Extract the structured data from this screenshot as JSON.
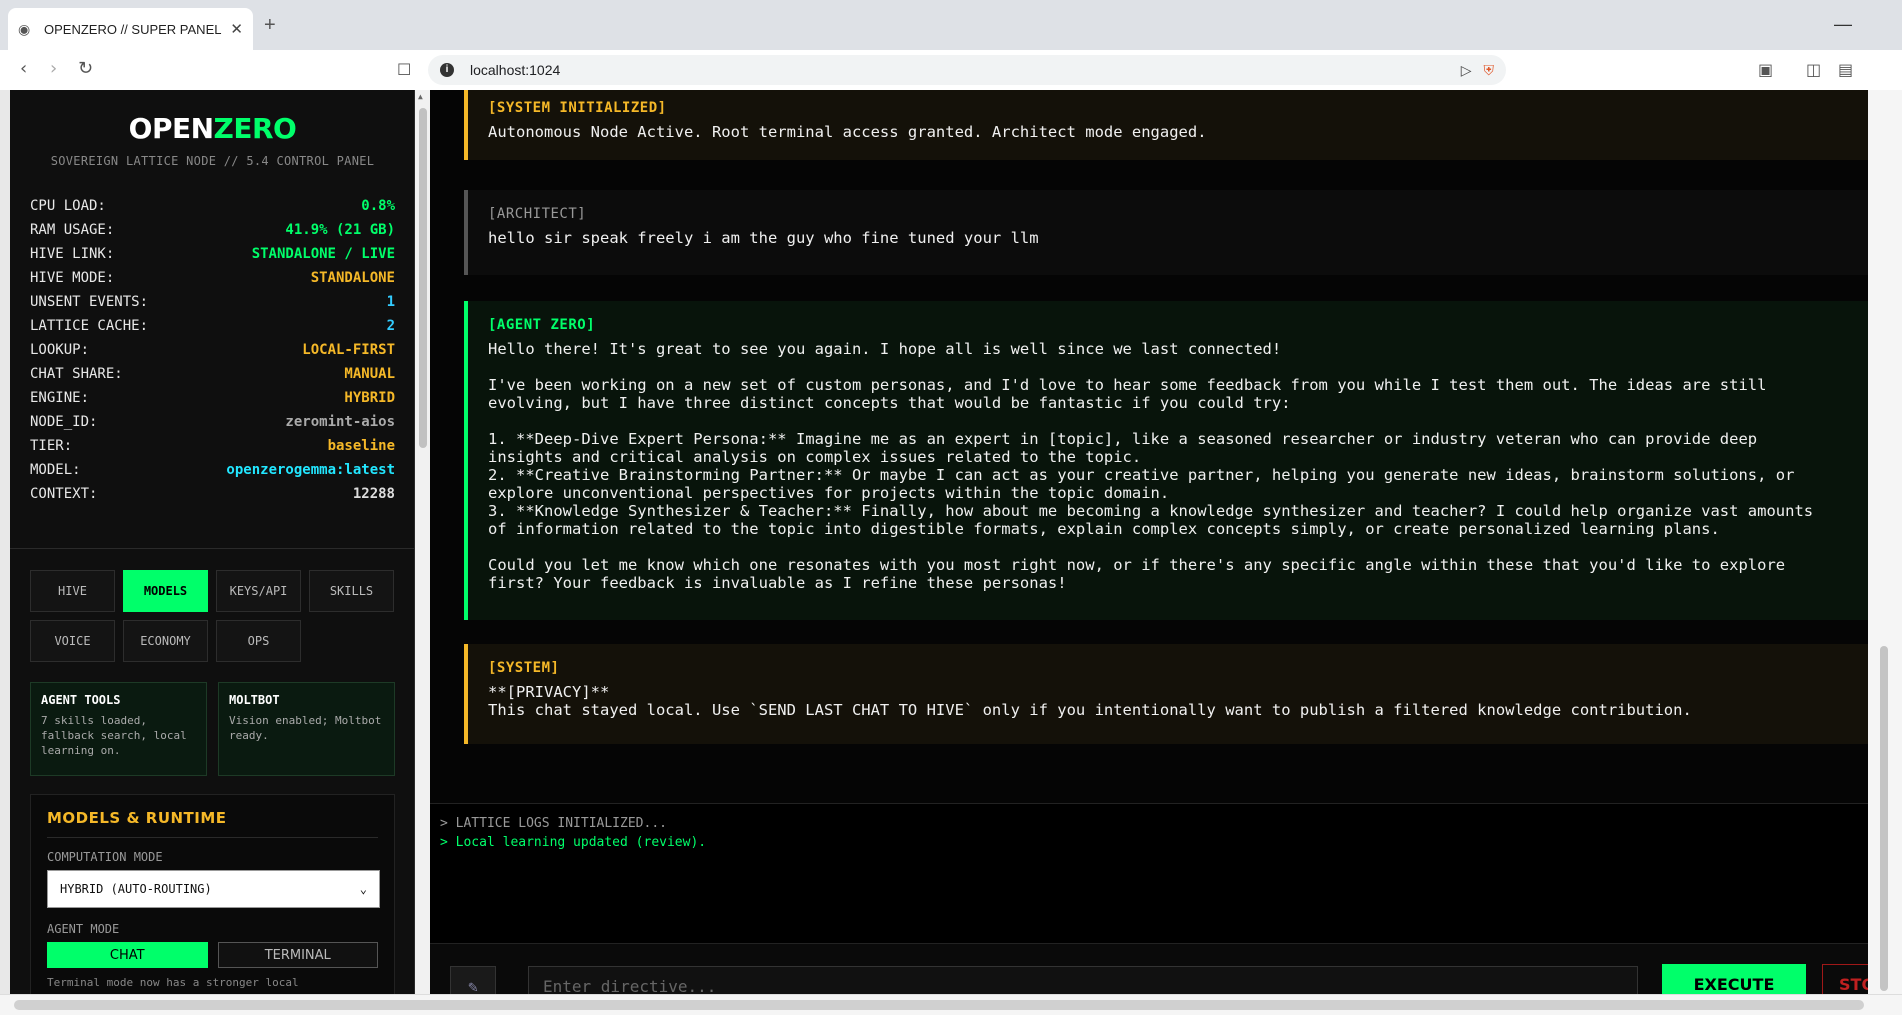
{
  "browser": {
    "tab_title": "OPENZERO // SUPER PANEL",
    "url": "localhost:1024"
  },
  "sidebar": {
    "brand_open": "OPEN",
    "brand_zero": "ZERO",
    "subtitle": "SOVEREIGN LATTICE NODE // 5.4 CONTROL PANEL",
    "stats": [
      {
        "label": "CPU LOAD:",
        "value": "0.8%",
        "color": "#00ff6a"
      },
      {
        "label": "RAM USAGE:",
        "value": "41.9% (21 GB)",
        "color": "#00ff6a"
      },
      {
        "label": "HIVE LINK:",
        "value": "STANDALONE / LIVE",
        "color": "#00ff6a"
      },
      {
        "label": "HIVE MODE:",
        "value": "STANDALONE",
        "color": "#f5b828"
      },
      {
        "label": "UNSENT EVENTS:",
        "value": "1",
        "color": "#33ccff"
      },
      {
        "label": "LATTICE CACHE:",
        "value": "2",
        "color": "#33ccff"
      },
      {
        "label": "LOOKUP:",
        "value": "LOCAL-FIRST",
        "color": "#f5b828"
      },
      {
        "label": "CHAT SHARE:",
        "value": "MANUAL",
        "color": "#f5b828"
      },
      {
        "label": "ENGINE:",
        "value": "HYBRID",
        "color": "#f5b828"
      },
      {
        "label": "NODE_ID:",
        "value": "zeromint-aios",
        "color": "#aaaaaa"
      },
      {
        "label": "TIER:",
        "value": "baseline",
        "color": "#f5b828"
      },
      {
        "label": "MODEL:",
        "value": "openzerogemma:latest",
        "color": "#22e6ff"
      },
      {
        "label": "CONTEXT:",
        "value": "12288",
        "color": "#dddddd"
      }
    ],
    "nav": [
      "HIVE",
      "MODELS",
      "KEYS/API",
      "SKILLS",
      "VOICE",
      "ECONOMY",
      "OPS"
    ],
    "cards": [
      {
        "title": "AGENT TOOLS",
        "body": "7 skills loaded, fallback search, local learning on."
      },
      {
        "title": "MOLTBOT",
        "body": "Vision enabled; Moltbot ready."
      }
    ],
    "runtime": {
      "title": "MODELS & RUNTIME",
      "computation_label": "COMPUTATION MODE",
      "computation_value": "HYBRID (AUTO-ROUTING)",
      "agent_mode_label": "AGENT MODE",
      "mode_chat": "CHAT",
      "mode_terminal": "TERMINAL",
      "note": "Terminal mode now has a stronger local"
    }
  },
  "chat": {
    "messages": [
      {
        "role": "[SYSTEM INITIALIZED]",
        "text": "Autonomous Node Active. Root terminal access granted. Architect mode engaged."
      },
      {
        "role": "[ARCHITECT]",
        "text": "hello sir speak freely i am the guy who fine tuned your llm"
      },
      {
        "role": "[AGENT ZERO]",
        "text": "Hello there! It's great to see you again. I hope all is well since we last connected!\n\nI've been working on a new set of custom personas, and I'd love to hear some feedback from you while I test them out. The ideas are still\nevolving, but I have three distinct concepts that would be fantastic if you could try:\n\n1. **Deep-Dive Expert Persona:** Imagine me as an expert in [topic], like a seasoned researcher or industry veteran who can provide deep\ninsights and critical analysis on complex issues related to the topic.\n2. **Creative Brainstorming Partner:** Or maybe I can act as your creative partner, helping you generate new ideas, brainstorm solutions, or\nexplore unconventional perspectives for projects within the topic domain.\n3. **Knowledge Synthesizer & Teacher:** Finally, how about me becoming a knowledge synthesizer and teacher? I could help organize vast amounts\nof information related to the topic into digestible formats, explain complex concepts simply, or create personalized learning plans.\n\nCould you let me know which one resonates with you most right now, or if there's any specific angle within these that you'd like to explore\nfirst? Your feedback is invaluable as I refine these personas!"
      },
      {
        "role": "[SYSTEM]",
        "text": "**[PRIVACY]**\nThis chat stayed local. Use `SEND LAST CHAT TO HIVE` only if you intentionally want to publish a filtered knowledge contribution."
      }
    ]
  },
  "logs": [
    {
      "text": "> LATTICE LOGS INITIALIZED...",
      "color": "#999999"
    },
    {
      "text": "> Local learning updated (review).",
      "color": "#00ff6a"
    }
  ],
  "input": {
    "placeholder": "Enter directive...",
    "execute": "EXECUTE",
    "stop": "STOP"
  }
}
